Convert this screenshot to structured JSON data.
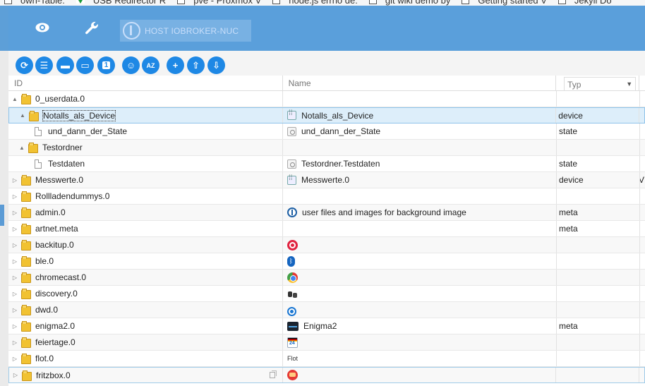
{
  "browser": {
    "bookmarks": [
      {
        "label": "own-Table:",
        "icon": "page-icon"
      },
      {
        "label": "USB Redirector R",
        "icon": "check-icon"
      },
      {
        "label": "pve - Proxmox V",
        "icon": "page-icon"
      },
      {
        "label": "node.js errno de:",
        "icon": "page-icon"
      },
      {
        "label": "git wiki demo by",
        "icon": "page-icon"
      },
      {
        "label": "Getting started V",
        "icon": "page-icon"
      },
      {
        "label": "Jekyll Do",
        "icon": "page-icon"
      }
    ]
  },
  "appbar": {
    "host_label": "HOST IOBROKER-NUC"
  },
  "toolbar": {
    "buttons": [
      "refresh",
      "list",
      "folder-open",
      "folder",
      "1",
      "user",
      "A-Z",
      "+",
      "upload",
      "download"
    ]
  },
  "grid": {
    "headers": {
      "id": "ID",
      "name": "Name",
      "typ": "Typ"
    },
    "rows": [
      {
        "id": "0_userdata.0",
        "name": "",
        "typ": "",
        "expander": "▲",
        "kind": "folder",
        "level": 0,
        "icon": ""
      },
      {
        "id": "Notalls_als_Device",
        "name": "Notalls_als_Device",
        "typ": "device",
        "expander": "▲",
        "kind": "folder",
        "level": 1,
        "icon": "device"
      },
      {
        "id": "und_dann_der_State",
        "name": "und_dann_der_State",
        "typ": "state",
        "expander": "",
        "kind": "file",
        "level": 2,
        "icon": "state"
      },
      {
        "id": "Testordner",
        "name": "",
        "typ": "",
        "expander": "▲",
        "kind": "folder",
        "level": 1,
        "icon": ""
      },
      {
        "id": "Testdaten",
        "name": "Testordner.Testdaten",
        "typ": "state",
        "expander": "",
        "kind": "file",
        "level": 2,
        "icon": "state"
      },
      {
        "id": "Messwerte.0",
        "name": "Messwerte.0",
        "typ": "device",
        "expander": "▷",
        "kind": "folder",
        "level": 0,
        "icon": "device",
        "extra": "V"
      },
      {
        "id": "Rollladendummys.0",
        "name": "",
        "typ": "",
        "expander": "▷",
        "kind": "folder",
        "level": 0,
        "icon": ""
      },
      {
        "id": "admin.0",
        "name": "user files and images for background image",
        "typ": "meta",
        "expander": "▷",
        "kind": "folder",
        "level": 0,
        "icon": "iob"
      },
      {
        "id": "artnet.meta",
        "name": "",
        "typ": "meta",
        "expander": "▷",
        "kind": "folder",
        "level": 0,
        "icon": ""
      },
      {
        "id": "backitup.0",
        "name": "",
        "typ": "",
        "expander": "▷",
        "kind": "folder",
        "level": 0,
        "icon": "backitup"
      },
      {
        "id": "ble.0",
        "name": "",
        "typ": "",
        "expander": "▷",
        "kind": "folder",
        "level": 0,
        "icon": "ble"
      },
      {
        "id": "chromecast.0",
        "name": "",
        "typ": "",
        "expander": "▷",
        "kind": "folder",
        "level": 0,
        "icon": "chromecast"
      },
      {
        "id": "discovery.0",
        "name": "",
        "typ": "",
        "expander": "▷",
        "kind": "folder",
        "level": 0,
        "icon": "discovery"
      },
      {
        "id": "dwd.0",
        "name": "",
        "typ": "",
        "expander": "▷",
        "kind": "folder",
        "level": 0,
        "icon": "dwd"
      },
      {
        "id": "enigma2.0",
        "name": "Enigma2",
        "typ": "meta",
        "expander": "▷",
        "kind": "folder",
        "level": 0,
        "icon": "enigma2"
      },
      {
        "id": "feiertage.0",
        "name": "",
        "typ": "",
        "expander": "▷",
        "kind": "folder",
        "level": 0,
        "icon": "feiertage"
      },
      {
        "id": "flot.0",
        "name": "",
        "typ": "",
        "expander": "▷",
        "kind": "folder",
        "level": 0,
        "icon": "flot",
        "icon_text": "Flot"
      },
      {
        "id": "fritzbox.0",
        "name": "",
        "typ": "",
        "expander": "▷",
        "kind": "folder",
        "level": 0,
        "icon": "fritzbox"
      }
    ]
  },
  "colors": {
    "appbar": "#5a9fdb",
    "button": "#1e88e5",
    "selected_row": "#ddeefa"
  }
}
